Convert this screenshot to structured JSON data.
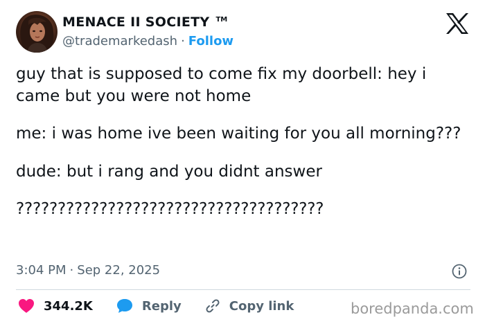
{
  "author": {
    "display_name": "MENACE II SOCIETY",
    "tm_mark": "TM",
    "handle": "@trademarkedash",
    "separator": "·",
    "follow_label": "Follow"
  },
  "tweet": {
    "paragraphs": [
      "guy that is supposed to come fix my doorbell: hey i came but you were not home",
      "me: i was home ive been waiting for you all morning???",
      "dude: but i rang and you didnt answer",
      "?????????????????????????????????????"
    ],
    "time": "3:04 PM",
    "date": "Sep 22, 2025"
  },
  "actions": {
    "likes": "344.2K",
    "reply_label": "Reply",
    "copy_link_label": "Copy link"
  },
  "watermark": "boredpanda.com",
  "colors": {
    "accent": "#1d9bf0",
    "like": "#f91880",
    "muted": "#536471",
    "text": "#0f1419",
    "divider": "#cfd9de"
  },
  "icons": [
    "x-logo-icon",
    "info-icon",
    "heart-icon",
    "reply-bubble-icon",
    "link-icon"
  ]
}
